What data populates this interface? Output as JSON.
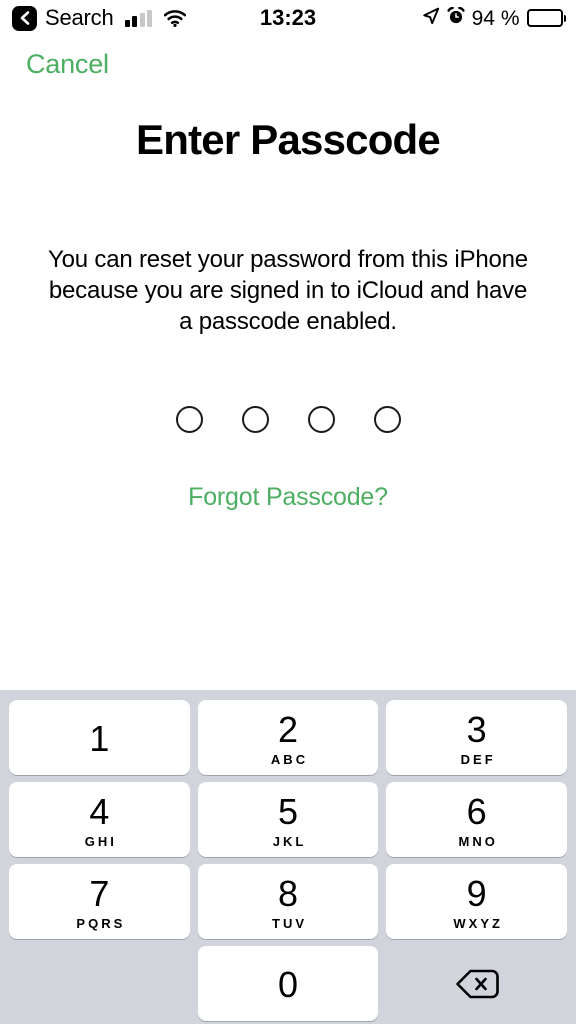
{
  "status_bar": {
    "back_icon": "chevron-left-icon",
    "carrier": "Search",
    "signal_icon": "cellular-signal-icon",
    "signal_bars_filled": 2,
    "signal_bars_total": 4,
    "wifi_icon": "wifi-icon",
    "time": "13:23",
    "location_icon": "location-arrow-icon",
    "alarm_icon": "alarm-clock-icon",
    "battery_percent": "94 %",
    "battery_icon": "battery-full-icon"
  },
  "nav": {
    "cancel_label": "Cancel"
  },
  "main": {
    "title": "Enter Passcode",
    "description": "You can reset your password from this iPhone because you are signed in to iCloud and have a passcode enabled.",
    "passcode_length": 4,
    "passcode_entered": 0,
    "forgot_label": "Forgot Passcode?"
  },
  "keypad": {
    "rows": [
      [
        {
          "digit": "1",
          "letters": ""
        },
        {
          "digit": "2",
          "letters": "ABC"
        },
        {
          "digit": "3",
          "letters": "DEF"
        }
      ],
      [
        {
          "digit": "4",
          "letters": "GHI"
        },
        {
          "digit": "5",
          "letters": "JKL"
        },
        {
          "digit": "6",
          "letters": "MNO"
        }
      ],
      [
        {
          "digit": "7",
          "letters": "PQRS"
        },
        {
          "digit": "8",
          "letters": "TUV"
        },
        {
          "digit": "9",
          "letters": "WXYZ"
        }
      ],
      [
        {
          "digit": "0",
          "letters": ""
        }
      ]
    ],
    "delete_icon": "delete-backspace-icon"
  },
  "colors": {
    "accent_green": "#4CAF62",
    "keypad_background": "#D1D5DB",
    "key_background": "#FFFFFF",
    "text_primary": "#000000",
    "page_background": "#FFFFFF"
  }
}
